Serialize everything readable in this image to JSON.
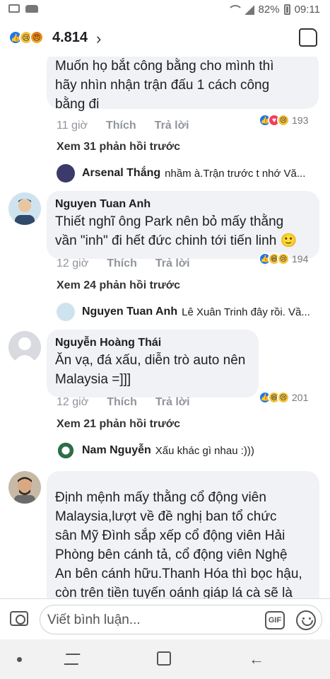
{
  "status_bar": {
    "battery": "82%",
    "time": "09:11"
  },
  "header": {
    "reaction_count": "4.814"
  },
  "comments": [
    {
      "text_lines": [
        "Muốn họ bắt công bằng cho mình thì",
        "hãy nhìn nhận trận đấu 1 cách công",
        "bằng đi"
      ],
      "time": "11 giờ",
      "like": "Thích",
      "reply": "Trả lời",
      "reactions": "193"
    },
    {
      "name": "Nguyen Tuan Anh",
      "text_lines": [
        "Thiết nghĩ ông Park nên bỏ mấy thằng",
        "vần \"inh\" đi hết đức chinh tới tiến linh 🙂"
      ],
      "time": "12 giờ",
      "like": "Thích",
      "reply": "Trả lời",
      "reactions": "194"
    },
    {
      "name": "Nguyễn Hoàng Thái",
      "text_lines": [
        "Ăn vạ, đá xấu, diễn trò auto nên",
        "Malaysia =]]]"
      ],
      "time": "12 giờ",
      "like": "Thích",
      "reply": "Trả lời",
      "reactions": "201"
    },
    {
      "text_lines": [
        "Định mệnh mấy thằng cổ động viên",
        "Malaysia,lượt về đề nghị ban tổ chức",
        "sân Mỹ Đình sắp xếp cổ động viên Hải",
        "Phòng bên cánh tả, cổ động viên Nghệ",
        "An bên cánh hữu.Thanh Hóa thì bọc hậu,",
        "còn trên tiền tuyến oánh giáp lá cà sẽ là"
      ]
    }
  ],
  "more_replies": [
    "Xem 31 phản hồi trước",
    "Xem 24 phản hồi trước",
    "Xem 21 phản hồi trước"
  ],
  "replies": [
    {
      "name": "Arsenal Thắng",
      "text": "nhầm à.Trận trước t nhớ Vă..."
    },
    {
      "name": "Nguyen Tuan Anh",
      "text": "Lê Xuân Trinh đây rồi. Vầ..."
    },
    {
      "name": "Nam Nguyễn",
      "text": "Xấu khác gì nhau :)))"
    }
  ],
  "composer": {
    "placeholder": "Viết bình luận...",
    "gif": "GIF"
  },
  "icons": {
    "camera": "camera-icon",
    "gif": "gif-icon",
    "emoji": "emoji-icon",
    "like_header": "thumbs-up-icon",
    "chevron": "chevron-right-icon"
  },
  "colors": {
    "like_blue": "#1877f2",
    "bubble_bg": "#f0f2f5",
    "meta_gray": "#90949c"
  }
}
